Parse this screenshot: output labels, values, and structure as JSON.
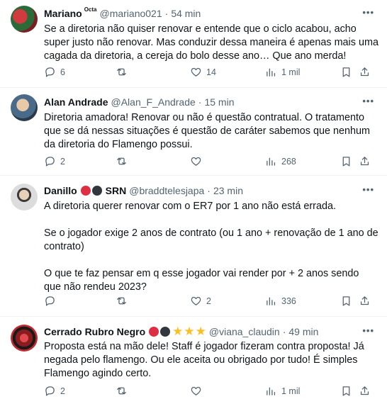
{
  "tweets": [
    {
      "name": "Mariano",
      "badge": "Octa",
      "handle": "@mariano021",
      "separator": "·",
      "time": "54 min",
      "text": "Se a diretoria não quiser renovar e entende que o ciclo acabou, acho super justo não renovar. Mas conduzir dessa maneira é apenas mais uma cagada da diretoria, a cereja do bolo desse ano… Que ano merda!",
      "replies": "6",
      "retweets": "",
      "likes": "14",
      "views": "1 mil",
      "avatar_colors": [
        "#b3262c",
        "#2b6b3a"
      ]
    },
    {
      "name": "Alan Andrade",
      "handle": "@Alan_F_Andrade",
      "separator": "·",
      "time": "15 min",
      "text": "Diretoria amadora! Renovar ou não é questão contratual. O tratamento que se dá nessas situações é questão de caráter sabemos que nenhum da diretoria do Flamengo possui.",
      "replies": "2",
      "retweets": "",
      "likes": "",
      "views": "268",
      "avatar_colors": [
        "#4a6a8a",
        "#e8c9a8"
      ]
    },
    {
      "name": "Danillo",
      "name_suffix": "SRN",
      "handle": "@braddtelesjapa",
      "separator": "·",
      "time": "23 min",
      "text": "A diretoria querer renovar com o ER7 por 1 ano não está errada.\n\nSe o jogador exige 2 anos de contrato (ou 1 ano + renovação de 1 ano de contrato)\n\nO que te faz pensar em q esse jogador vai render por + 2 anos sendo que não rendeu 2023?",
      "replies": "",
      "retweets": "",
      "likes": "2",
      "views": "336",
      "avatar_colors": [
        "#d9d9d9",
        "#3a3a3a"
      ]
    },
    {
      "name": "Cerrado Rubro Negro",
      "handle": "@viana_claudin",
      "separator": "·",
      "time": "49 min",
      "text": "Proposta está na mão dele! Staff é jogador fizeram contra proposta! Já negada pelo flamengo. Ou ele aceita ou obrigado por tudo! É simples Flamengo agindo certo.",
      "replies": "2",
      "retweets": "",
      "likes": "",
      "views": "1 mil",
      "avatar_colors": [
        "#c0282d",
        "#1a1a1a"
      ]
    }
  ],
  "icons": {
    "more": "more-icon",
    "reply": "reply-icon",
    "retweet": "retweet-icon",
    "like": "heart-icon",
    "views": "views-icon",
    "bookmark": "bookmark-icon",
    "share": "share-icon"
  },
  "colors": {
    "text": "#0f1419",
    "muted": "#536471",
    "divider": "#eff3f4",
    "star": "#fcbf20"
  }
}
